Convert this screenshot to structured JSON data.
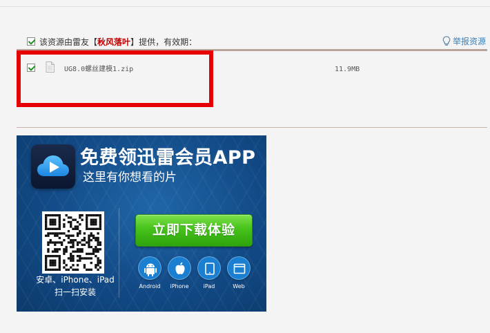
{
  "header": {
    "prefix": "该资源由雷友",
    "bracket_open": "【",
    "sharer": "秋风落叶",
    "bracket_close": "】",
    "suffix": "提供，有效期：",
    "report_label": "举报资源"
  },
  "file": {
    "name": "UG8.0螺丝建模1.zip",
    "size": "11.9MB",
    "checked": true
  },
  "banner": {
    "title": "免费领迅雷会员APP",
    "subtitle": "这里有你想看的片",
    "qr_caption_line1": "安卓、iPhone、iPad",
    "qr_caption_line2": "扫一扫安装",
    "download_label": "立即下载体验",
    "platforms": [
      {
        "label": "Android",
        "icon": "android-icon"
      },
      {
        "label": "iPhone",
        "icon": "apple-icon"
      },
      {
        "label": "iPad",
        "icon": "ipad-icon"
      },
      {
        "label": "Web",
        "icon": "web-icon"
      }
    ]
  },
  "colors": {
    "sharer": "#c00000",
    "report_link": "#3a7fb5",
    "highlight": "#e60000",
    "download_button": "#46c21a",
    "banner_bg": "#124a86"
  }
}
